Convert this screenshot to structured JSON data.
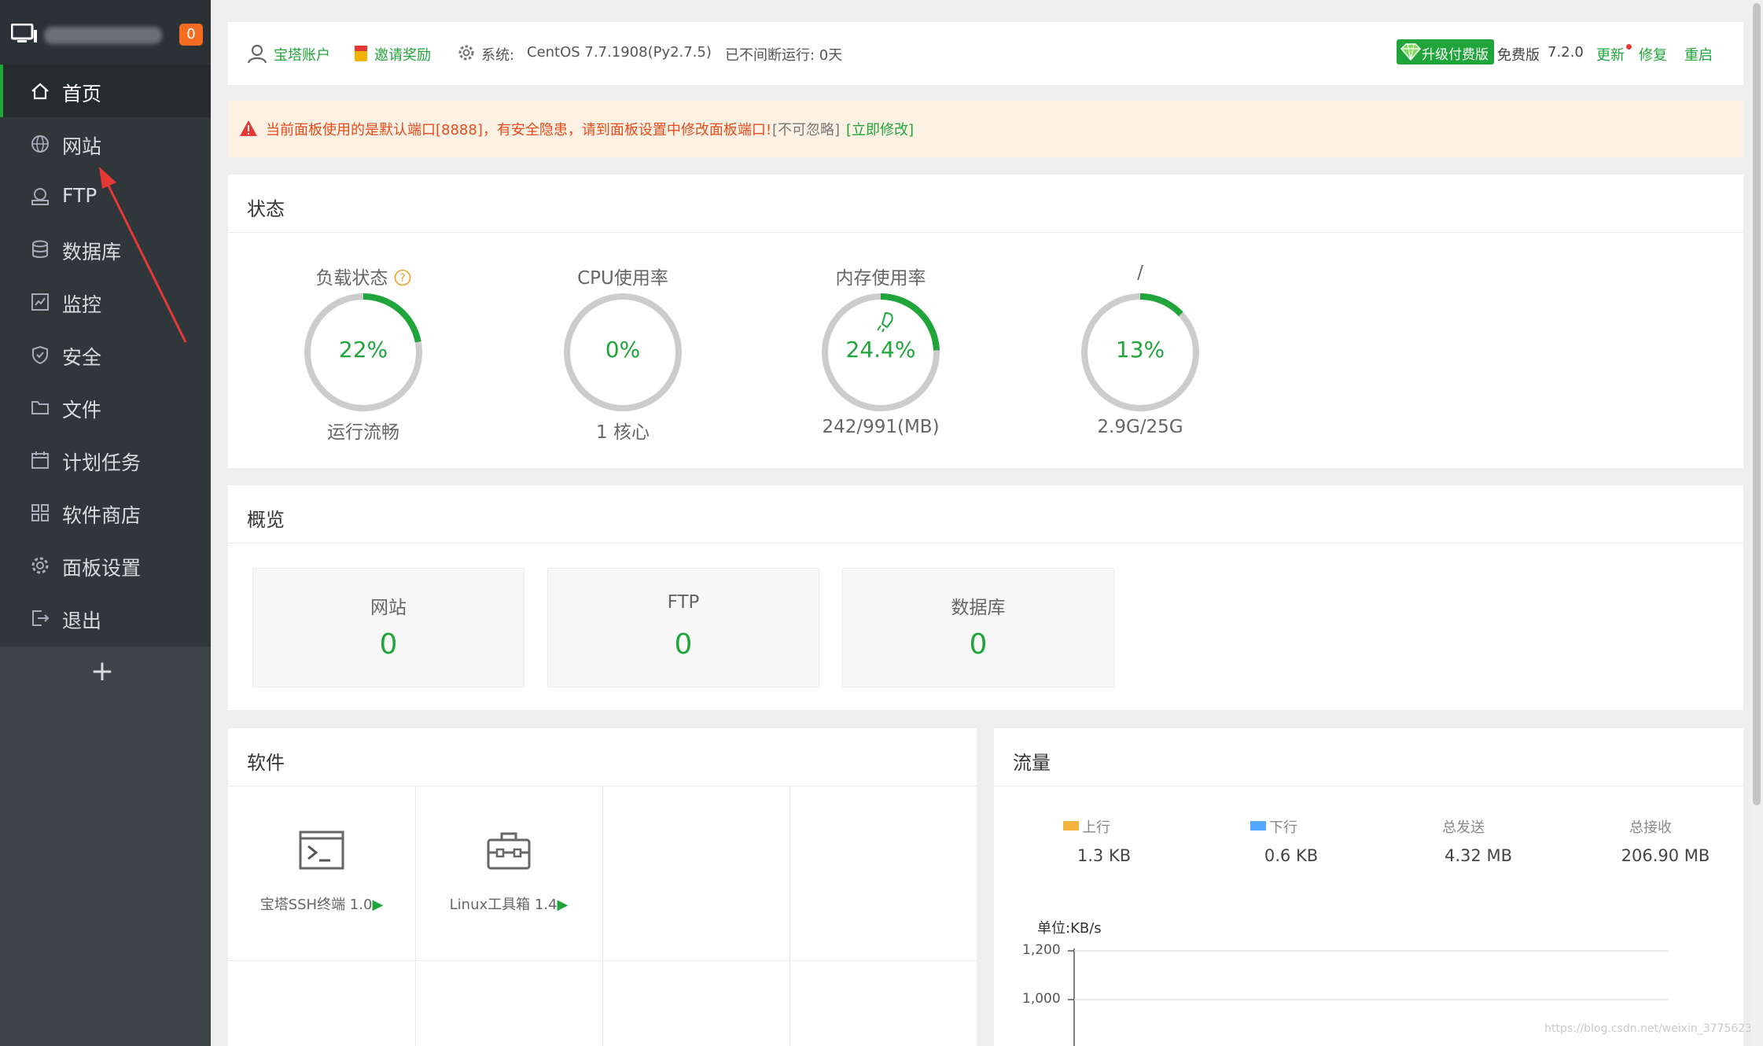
{
  "sidebar": {
    "badge": "0",
    "items": [
      {
        "label": "首页",
        "icon": "home-icon"
      },
      {
        "label": "网站",
        "icon": "globe-icon"
      },
      {
        "label": "FTP",
        "icon": "ftp-icon"
      },
      {
        "label": "数据库",
        "icon": "database-icon"
      },
      {
        "label": "监控",
        "icon": "monitor-icon"
      },
      {
        "label": "安全",
        "icon": "shield-icon"
      },
      {
        "label": "文件",
        "icon": "folder-icon"
      },
      {
        "label": "计划任务",
        "icon": "calendar-icon"
      },
      {
        "label": "软件商店",
        "icon": "grid-icon"
      },
      {
        "label": "面板设置",
        "icon": "gear-icon"
      },
      {
        "label": "退出",
        "icon": "logout-icon"
      }
    ],
    "add_label": "+"
  },
  "header": {
    "account": "宝塔账户",
    "invite": "邀请奖励",
    "system_label": "系统:",
    "system_value": "CentOS 7.7.1908(Py2.7.5)",
    "uptime": "已不间断运行: 0天",
    "upgrade": "升级付费版",
    "edition": "免费版",
    "version": "7.2.0",
    "update": "更新",
    "repair": "修复",
    "restart": "重启"
  },
  "alert": {
    "text": "当前面板使用的是默认端口[8888]，有安全隐患，请到面板设置中修改面板端口!",
    "ignore": "[不可忽略]",
    "fix": "[立即修改]"
  },
  "status": {
    "title": "状态",
    "gauges": [
      {
        "label": "负载状态",
        "value": "22%",
        "fraction": 0.22,
        "sub": "运行流畅"
      },
      {
        "label": "CPU使用率",
        "value": "0%",
        "fraction": 0.0,
        "sub": "1 核心"
      },
      {
        "label": "内存使用率",
        "value": "24.4%",
        "fraction": 0.244,
        "sub": "242/991(MB)"
      },
      {
        "label": "/",
        "value": "13%",
        "fraction": 0.13,
        "sub": "2.9G/25G"
      }
    ]
  },
  "overview": {
    "title": "概览",
    "boxes": [
      {
        "label": "网站",
        "value": "0"
      },
      {
        "label": "FTP",
        "value": "0"
      },
      {
        "label": "数据库",
        "value": "0"
      }
    ]
  },
  "software": {
    "title": "软件",
    "items": [
      {
        "label": "宝塔SSH终端 1.0",
        "icon": "terminal-icon"
      },
      {
        "label": "Linux工具箱 1.4",
        "icon": "toolbox-icon"
      }
    ]
  },
  "traffic": {
    "title": "流量",
    "stats": [
      {
        "label": "上行",
        "value": "1.3 KB",
        "color": "#f3b33e"
      },
      {
        "label": "下行",
        "value": "0.6 KB",
        "color": "#52a9ff"
      },
      {
        "label": "总发送",
        "value": "4.32 MB"
      },
      {
        "label": "总接收",
        "value": "206.90 MB"
      }
    ],
    "unit": "单位:KB/s",
    "yticks": [
      "1,200",
      "1,000"
    ]
  },
  "watermark": "https://blog.csdn.net/weixin_37756237",
  "colors": {
    "accent": "#20a53a",
    "sidebar": "#3d4447",
    "alert_bg": "#fdf1e4",
    "alert_text": "#e64c1c"
  }
}
